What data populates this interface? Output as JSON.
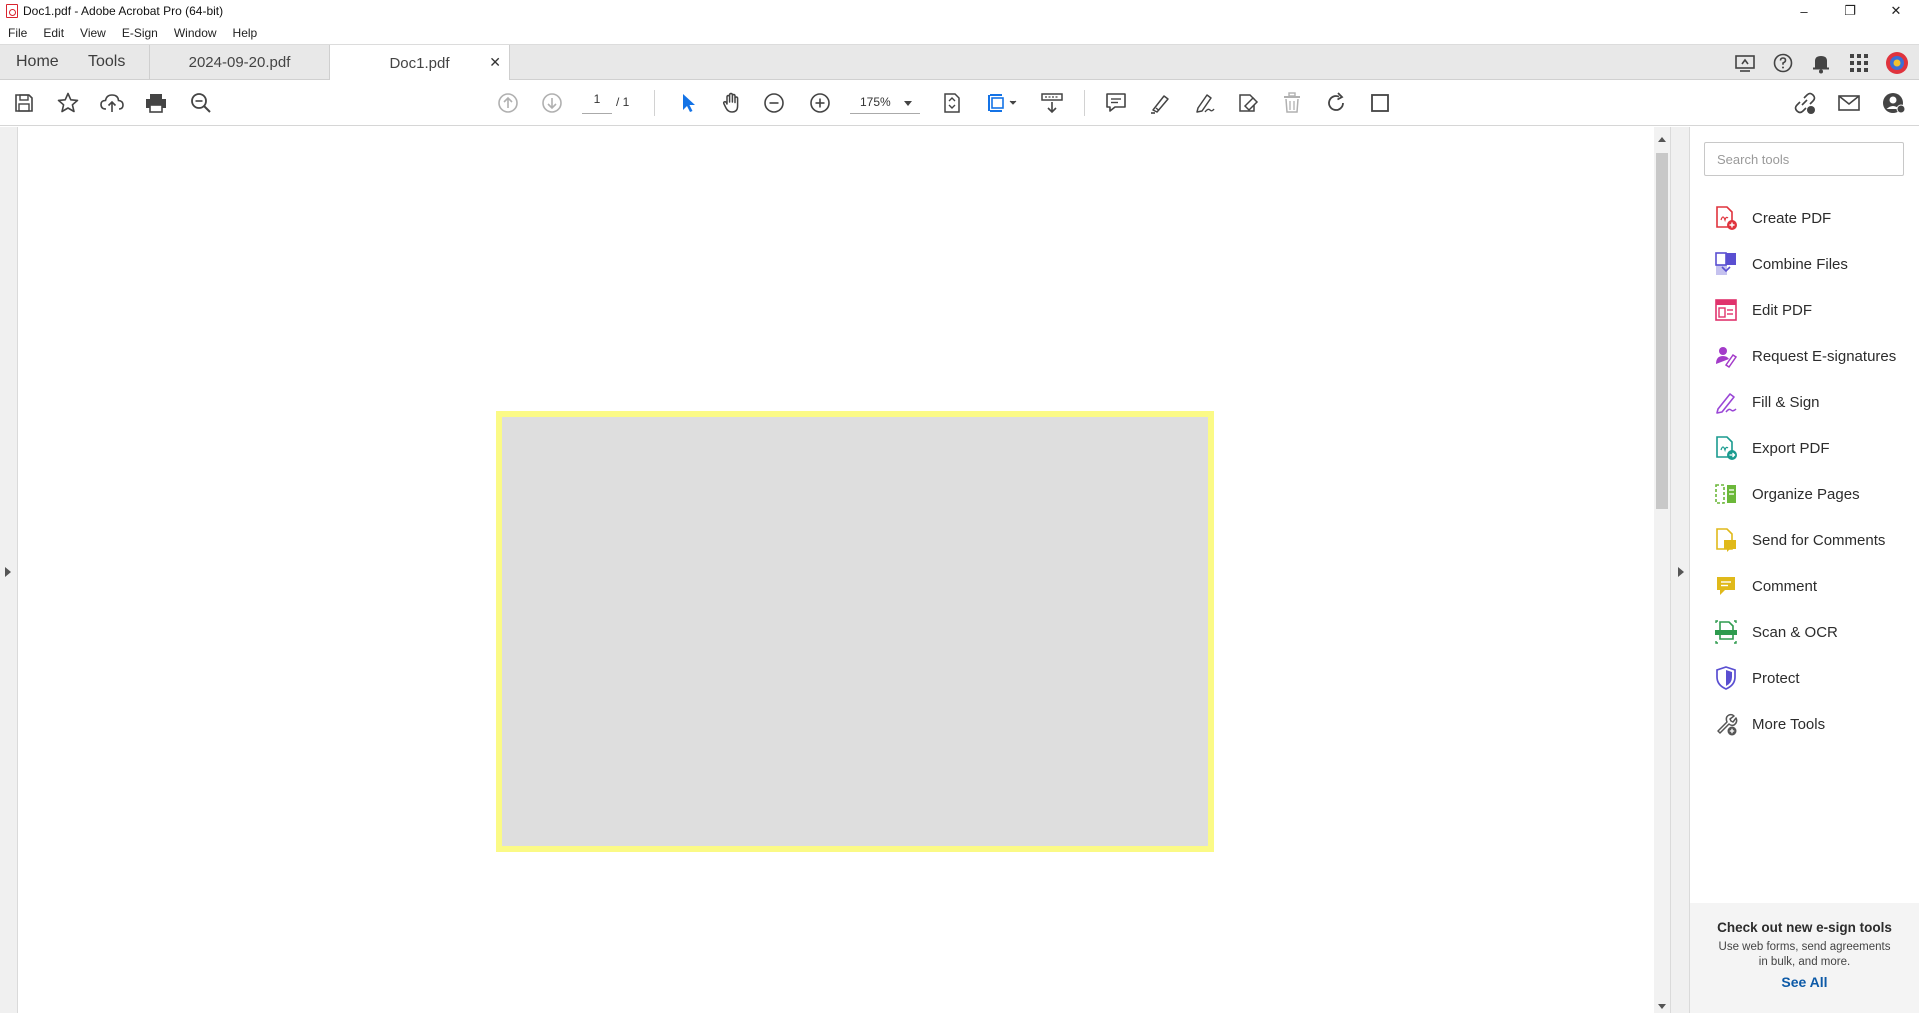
{
  "window": {
    "title": "Doc1.pdf - Adobe Acrobat Pro (64-bit)",
    "minimize": "–",
    "restore": "❐",
    "close": "✕"
  },
  "menu": [
    "File",
    "Edit",
    "View",
    "E-Sign",
    "Window",
    "Help"
  ],
  "tabs": {
    "home": "Home",
    "tools": "Tools",
    "documents": [
      {
        "label": "2024-09-20.pdf",
        "active": false
      },
      {
        "label": "Doc1.pdf",
        "active": true
      }
    ],
    "close_glyph": "✕"
  },
  "toolbar": {
    "page_current": "1",
    "page_total": "/ 1",
    "zoom": "175%"
  },
  "tools_pane": {
    "search_placeholder": "Search tools",
    "items": [
      {
        "label": "Create PDF",
        "icon": "create-pdf-icon",
        "color": "#e0333d"
      },
      {
        "label": "Combine Files",
        "icon": "combine-files-icon",
        "color": "#5a4fd1"
      },
      {
        "label": "Edit PDF",
        "icon": "edit-pdf-icon",
        "color": "#e0336d"
      },
      {
        "label": "Request E-signatures",
        "icon": "request-esignatures-icon",
        "color": "#a33bc9"
      },
      {
        "label": "Fill & Sign",
        "icon": "fill-sign-icon",
        "color": "#9a46d6"
      },
      {
        "label": "Export PDF",
        "icon": "export-pdf-icon",
        "color": "#1a9b8f"
      },
      {
        "label": "Organize Pages",
        "icon": "organize-pages-icon",
        "color": "#6cb83a"
      },
      {
        "label": "Send for Comments",
        "icon": "send-for-comments-icon",
        "color": "#e0b91a"
      },
      {
        "label": "Comment",
        "icon": "comment-icon",
        "color": "#e0b91a"
      },
      {
        "label": "Scan & OCR",
        "icon": "scan-ocr-icon",
        "color": "#2e9b4e"
      },
      {
        "label": "Protect",
        "icon": "protect-icon",
        "color": "#5a4fd1"
      },
      {
        "label": "More Tools",
        "icon": "more-tools-icon",
        "color": "#555555"
      }
    ],
    "promo": {
      "title": "Check out new e-sign tools",
      "description": "Use web forms, send agreements in bulk, and more.",
      "link": "See All"
    }
  },
  "colors": {
    "accent_blue": "#1473e6",
    "highlight_yellow": "#fbfa86",
    "page_fill": "#dedede"
  }
}
